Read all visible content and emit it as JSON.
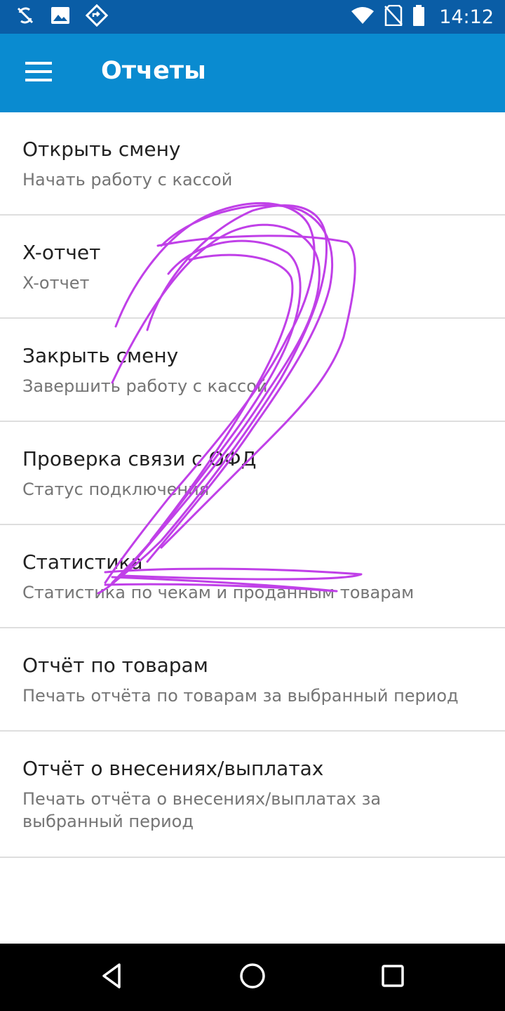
{
  "status_bar": {
    "time": "14:12",
    "left_icons": [
      "sync-disabled-icon",
      "image-icon",
      "navigation-diamond-icon"
    ],
    "right_icons": [
      "wifi-icon",
      "no-sim-icon",
      "battery-icon"
    ]
  },
  "app_bar": {
    "title": "Отчеты",
    "menu_icon": "hamburger-menu-icon",
    "color": "#0a8bd0",
    "status_color": "#0a5da6"
  },
  "items": [
    {
      "title": "Открыть смену",
      "subtitle": "Начать работу с кассой"
    },
    {
      "title": "X-отчет",
      "subtitle": "X-отчет"
    },
    {
      "title": "Закрыть смену",
      "subtitle": "Завершить работу с кассой"
    },
    {
      "title": "Проверка связи с ОФД",
      "subtitle": "Статус подключения"
    },
    {
      "title": "Статистика",
      "subtitle": "Статистика по чекам и проданным товарам"
    },
    {
      "title": "Отчёт по товарам",
      "subtitle": "Печать отчёта по товарам за выбранный период"
    },
    {
      "title": "Отчёт о внесениях/выплатах",
      "subtitle": "Печать отчёта о внесениях/выплатах за выбранный период"
    }
  ],
  "nav_bar": {
    "buttons": [
      "back-icon",
      "home-icon",
      "recents-icon"
    ]
  },
  "annotation": {
    "color": "#c040e8"
  }
}
